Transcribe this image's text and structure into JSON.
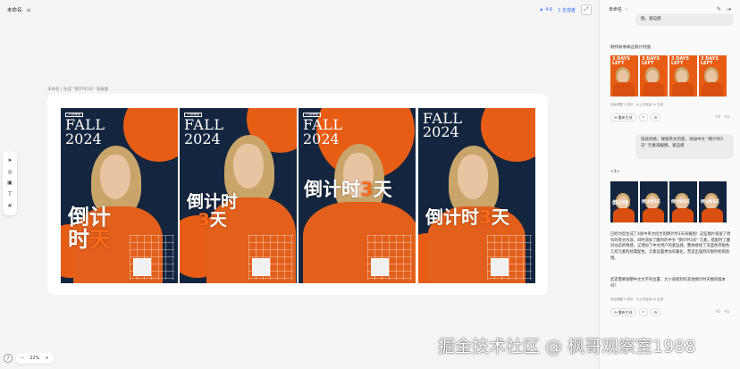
{
  "topbar": {
    "title": "未命名",
    "credits": "4.6",
    "share_label": "1 生成者"
  },
  "canvas": {
    "frame_label": "未命名 | 生成 \"倒计时3天\" 海报图",
    "posters": [
      {
        "tag": "人物海报",
        "line1": "FALL",
        "line2": "2024",
        "cn_a": "倒计",
        "cn_b": "时",
        "cn_c": "天"
      },
      {
        "tag": "人物海报",
        "line1": "FALL",
        "line2": "2024",
        "cn_a": "倒计时",
        "cn_b": "3",
        "cn_c": "天"
      },
      {
        "tag": "人物海报",
        "line1": "FALL",
        "line2": "2024",
        "cn_a": "倒计时",
        "cn_b": "3",
        "cn_c": "天"
      },
      {
        "tag": "",
        "line1": "FALL",
        "line2": "2024",
        "cn_a": "倒计时",
        "cn_b": "3",
        "cn_c": "天"
      }
    ],
    "zoom": "22%",
    "zoom_minus": "−",
    "zoom_plus": "+"
  },
  "chat": {
    "header_title": "未命名",
    "top_bubble": "图，紧迫感",
    "section1": "制作秋季邮这款计时图",
    "thumbs1": [
      "3 DAYS LEFT",
      "3 DAYS LEFT",
      "3 DAYS LEFT",
      "3 DAYS LEFT"
    ],
    "meta1": "未经调整 2 积分 · 以上内容由 AI 生成",
    "retry_label": "重新生成",
    "user_bubble": "延续风格，保留英文内容，添加中文 \"倒计时3天\" 元素海报图，紧迫感",
    "section2": "<1>",
    "thumbs2": [
      "倒计时",
      "倒计时3天",
      "倒计时3天",
      "倒计时3天"
    ],
    "reply": "已经为您生成了4张中英文结合的倒计时3天海报图！这些图片保留了原有的英文内容，同时添加了醒目的中文 \"倒计时3天\" 元素，搭配时了醒目动态的特感，又增加了中文用户的紧迫感。整体继续了深蓝色带橙色几何元素的经典配色，元素设置更加有趣化，营造出强烈的限时抢购氛围。",
    "reply2": "您还需要调整中文文字的位置、大小或者制作其他倒计时天数的版本吗？",
    "meta2": "未经调整 2 积分 · 以上内容由 AI 生成"
  },
  "watermark": "掘金技术社区 @ 枫哥观察室1988",
  "colors": {
    "navy": "#14253f",
    "orange": "#e85d15",
    "accent": "#2f6bff"
  }
}
